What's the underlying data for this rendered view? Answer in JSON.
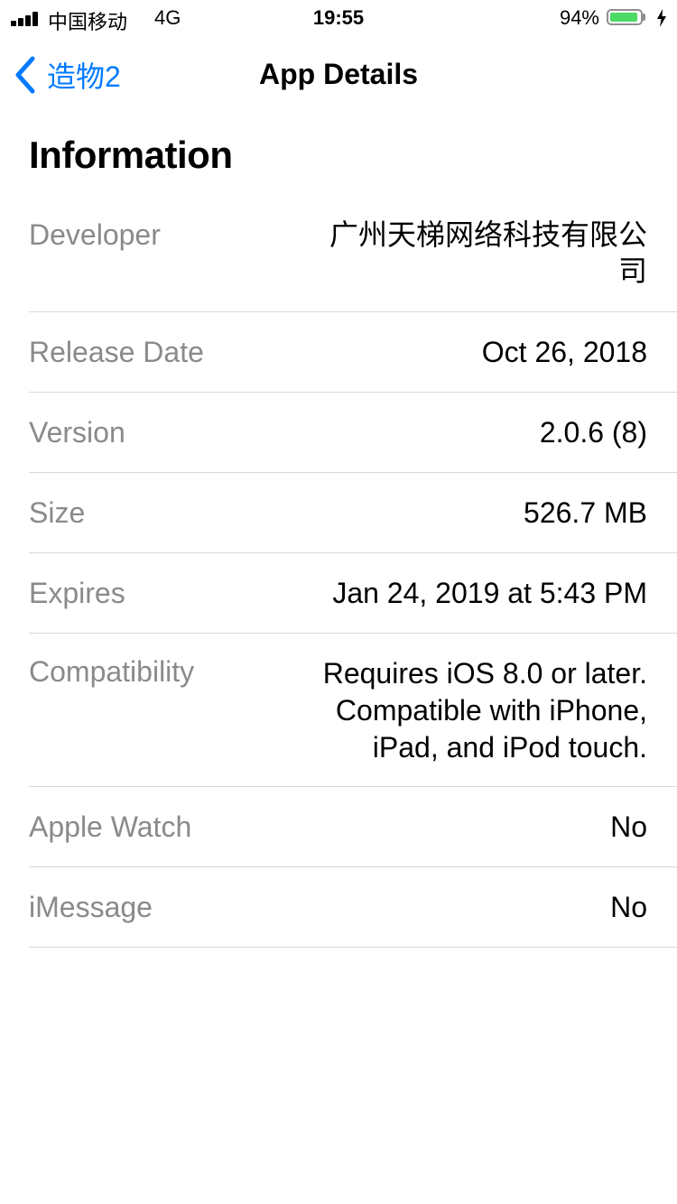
{
  "status_bar": {
    "carrier": "中国移动",
    "network": "4G",
    "time": "19:55",
    "battery_percent": "94%",
    "battery_level": 0.94,
    "battery_color": "#4cd964"
  },
  "nav": {
    "back_label": "造物2",
    "title": "App Details",
    "accent_color": "#007aff"
  },
  "section": {
    "title": "Information"
  },
  "info": {
    "developer": {
      "label": "Developer",
      "value": "广州天梯网络科技有限公司"
    },
    "release_date": {
      "label": "Release Date",
      "value": "Oct 26, 2018"
    },
    "version": {
      "label": "Version",
      "value": "2.0.6 (8)"
    },
    "size": {
      "label": "Size",
      "value": "526.7 MB"
    },
    "expires": {
      "label": "Expires",
      "value": "Jan 24, 2019 at 5:43 PM"
    },
    "compatibility": {
      "label": "Compatibility",
      "lines": [
        "Requires iOS 8.0 or later.",
        "Compatible with iPhone,",
        "iPad, and iPod touch."
      ]
    },
    "apple_watch": {
      "label": "Apple Watch",
      "value": "No"
    },
    "imessage": {
      "label": "iMessage",
      "value": "No"
    }
  }
}
